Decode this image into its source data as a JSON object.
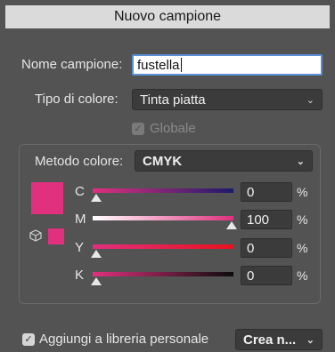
{
  "window": {
    "title": "Nuovo campione"
  },
  "name_field": {
    "label": "Nome campione:",
    "value": "fustella"
  },
  "color_type": {
    "label": "Tipo di colore:",
    "value": "Tinta piatta"
  },
  "global_option": {
    "label": "Globale",
    "checked": true,
    "enabled": false
  },
  "color_mode": {
    "label": "Metodo colore:",
    "value": "CMYK"
  },
  "swatch_color": "#e0307e",
  "channels": [
    {
      "label": "C",
      "value": "0",
      "unit": "%"
    },
    {
      "label": "M",
      "value": "100",
      "unit": "%"
    },
    {
      "label": "Y",
      "value": "0",
      "unit": "%"
    },
    {
      "label": "K",
      "value": "0",
      "unit": "%"
    }
  ],
  "footer": {
    "add_to_library_label": "Aggiungi a libreria personale",
    "add_to_library_checked": true,
    "library_select_value": "Crea n..."
  },
  "colors": {
    "background": "#535353",
    "title_bar": "#dadada",
    "focus_ring": "#5a8fd6",
    "magenta": "#e0307e"
  }
}
